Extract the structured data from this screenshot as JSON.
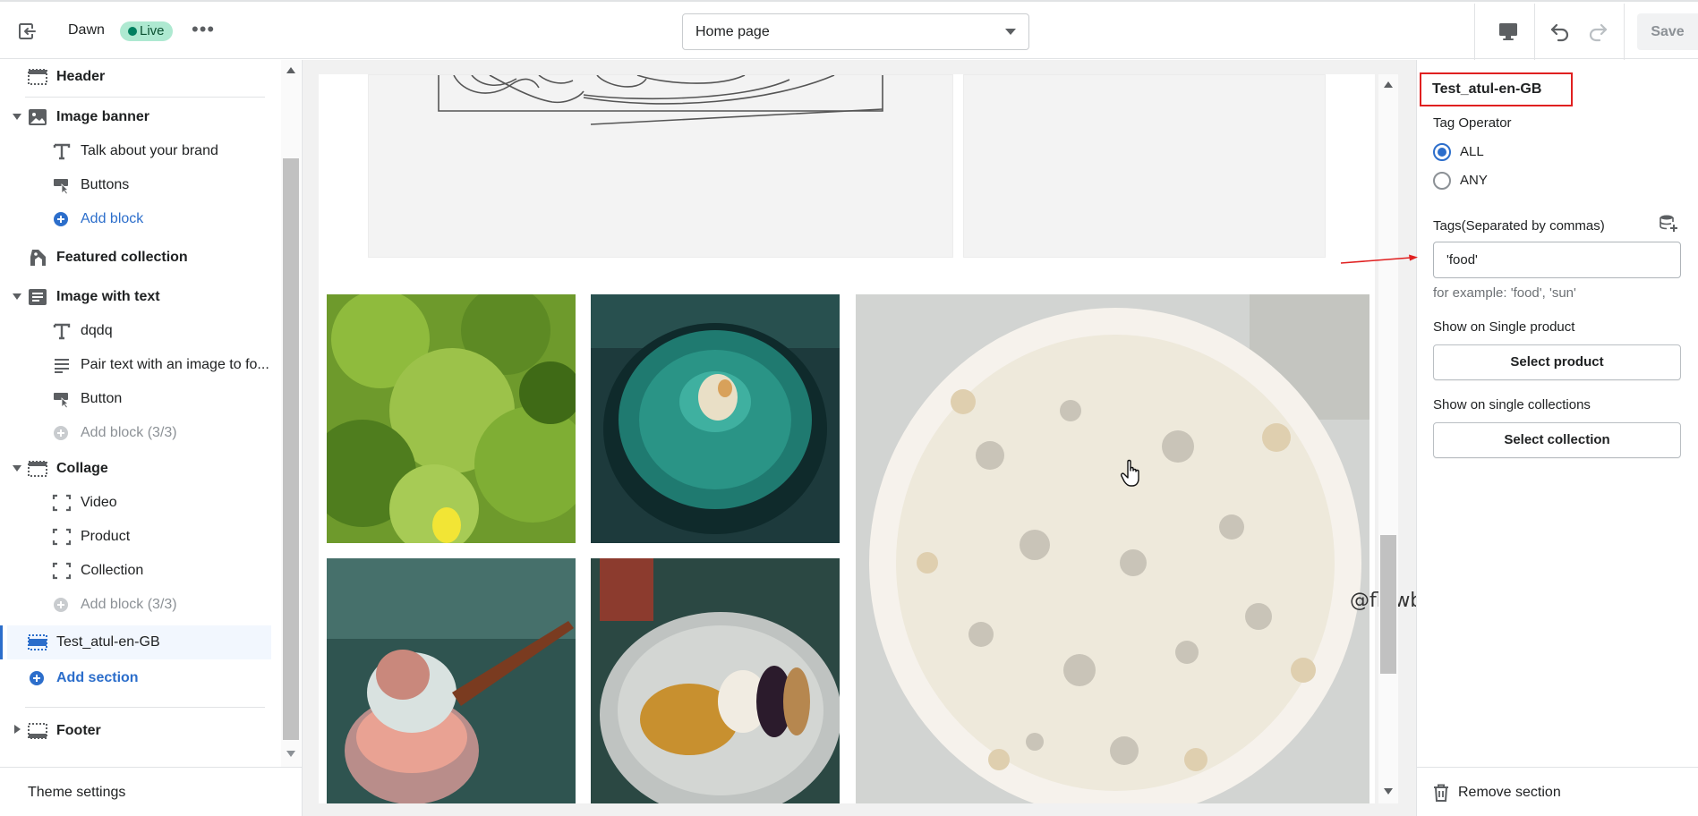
{
  "topbar": {
    "theme_name": "Dawn",
    "live_badge": "Live",
    "more_label": "•••",
    "page_select_value": "Home page",
    "save_label": "Save"
  },
  "sidebar": {
    "items": [
      {
        "type": "section",
        "label": "Header",
        "icon": "header-icon"
      },
      {
        "type": "section",
        "label": "Image banner",
        "icon": "image-icon",
        "expanded": true
      },
      {
        "type": "block",
        "label": "Talk about your brand",
        "icon": "text-icon"
      },
      {
        "type": "block",
        "label": "Buttons",
        "icon": "button-icon"
      },
      {
        "type": "add",
        "label": "Add block"
      },
      {
        "type": "section",
        "label": "Featured collection",
        "icon": "tag-icon"
      },
      {
        "type": "section",
        "label": "Image with text",
        "icon": "image-text-icon",
        "expanded": true
      },
      {
        "type": "block",
        "label": "dqdq",
        "icon": "text-icon"
      },
      {
        "type": "block",
        "label": "Pair text with an image to fo...",
        "icon": "paragraph-icon"
      },
      {
        "type": "block",
        "label": "Button",
        "icon": "button-icon"
      },
      {
        "type": "add-disabled",
        "label": "Add block (3/3)"
      },
      {
        "type": "section",
        "label": "Collage",
        "icon": "collage-icon",
        "expanded": true
      },
      {
        "type": "block",
        "label": "Video",
        "icon": "frame-icon"
      },
      {
        "type": "block",
        "label": "Product",
        "icon": "frame-icon"
      },
      {
        "type": "block",
        "label": "Collection",
        "icon": "frame-icon"
      },
      {
        "type": "add-disabled",
        "label": "Add block (3/3)"
      },
      {
        "type": "selected",
        "label": "Test_atul-en-GB",
        "icon": "section-icon"
      },
      {
        "type": "add-section",
        "label": "Add section"
      },
      {
        "type": "section",
        "label": "Footer",
        "icon": "footer-icon",
        "expanded": false
      }
    ],
    "theme_settings": "Theme settings"
  },
  "preview": {
    "overlay_handle": "@flowboxdev"
  },
  "panel": {
    "title": "Test_atul-en-GB",
    "tag_operator_label": "Tag Operator",
    "option_all": "ALL",
    "option_any": "ANY",
    "selected_option": "ALL",
    "tags_label": "Tags(Separated by commas)",
    "tags_value": "'food'",
    "tags_help": "for example: 'food', 'sun'",
    "single_product_label": "Show on Single product",
    "select_product": "Select product",
    "single_collections_label": "Show on single collections",
    "select_collection": "Select collection",
    "remove_section": "Remove section"
  },
  "colors": {
    "accent": "#2c6ecb",
    "live_bg": "#aee9d1",
    "highlight_box": "#e02020"
  }
}
